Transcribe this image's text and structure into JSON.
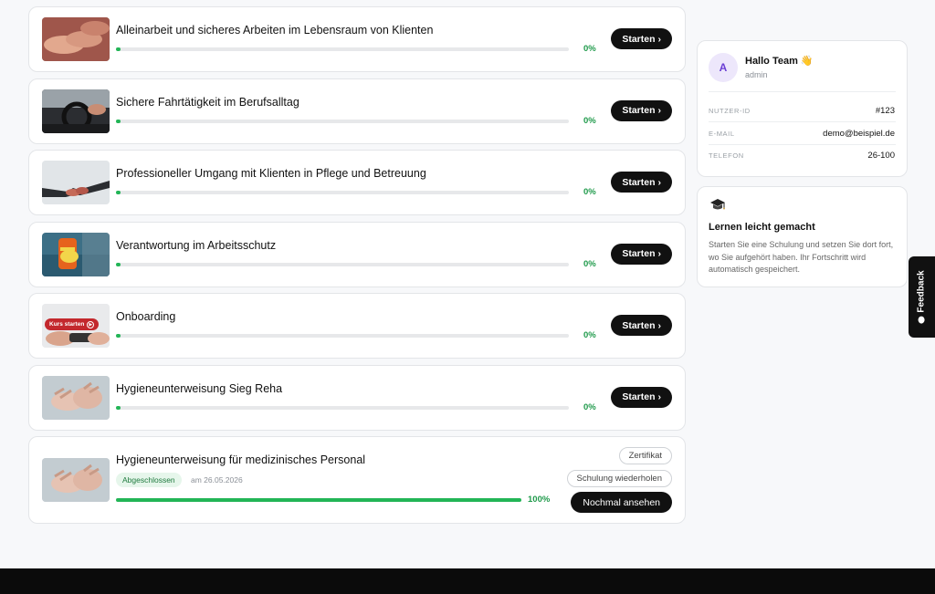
{
  "courses": [
    {
      "title": "Alleinarbeit und sicheres Arbeiten im Lebensraum von Klienten",
      "progress_label": "0%",
      "progress": 0.01,
      "action_label": "Starten"
    },
    {
      "title": "Sichere Fahrtätigkeit im Berufsalltag",
      "progress_label": "0%",
      "progress": 0.01,
      "action_label": "Starten"
    },
    {
      "title": "Professioneller Umgang mit Klienten in Pflege und Betreuung",
      "progress_label": "0%",
      "progress": 0.01,
      "action_label": "Starten"
    },
    {
      "title": "Verantwortung im Arbeitsschutz",
      "progress_label": "0%",
      "progress": 0.01,
      "action_label": "Starten"
    },
    {
      "title": "Onboarding",
      "progress_label": "0%",
      "progress": 0.01,
      "action_label": "Starten",
      "thumb_text": "Kurs starten"
    },
    {
      "title": "Hygieneunterweisung Sieg Reha",
      "progress_label": "0%",
      "progress": 0.01,
      "action_label": "Starten"
    }
  ],
  "completed_course": {
    "title": "Hygieneunterweisung für medizinisches Personal",
    "status_badge": "Abgeschlossen",
    "completed_date": "am 26.05.2026",
    "progress_label": "100%",
    "progress": 1.0,
    "certificate_label": "Zertifikat",
    "repeat_label": "Schulung wiederholen",
    "review_label": "Nochmal ansehen"
  },
  "profile": {
    "avatar_initial": "A",
    "greeting": "Hallo Team 👋",
    "role": "admin",
    "rows": [
      {
        "key": "NUTZER-ID",
        "value": "#123"
      },
      {
        "key": "E-MAIL",
        "value": "demo@beispiel.de"
      },
      {
        "key": "TELEFON",
        "value": "26-100"
      }
    ]
  },
  "tip": {
    "icon": "graduation-cap-icon",
    "title": "Lernen leicht gemacht",
    "text": "Starten Sie eine Schulung und setzen Sie dort fort, wo Sie aufgehört haben. Ihr Fortschritt wird automatisch gespeichert."
  },
  "feedback": {
    "label": "Feedback",
    "icon": "chat-bubble-icon"
  },
  "colors": {
    "accent": "#22b556",
    "button_dark": "#111111",
    "avatar_bg": "#ede7fb",
    "avatar_fg": "#6b3fd4"
  }
}
